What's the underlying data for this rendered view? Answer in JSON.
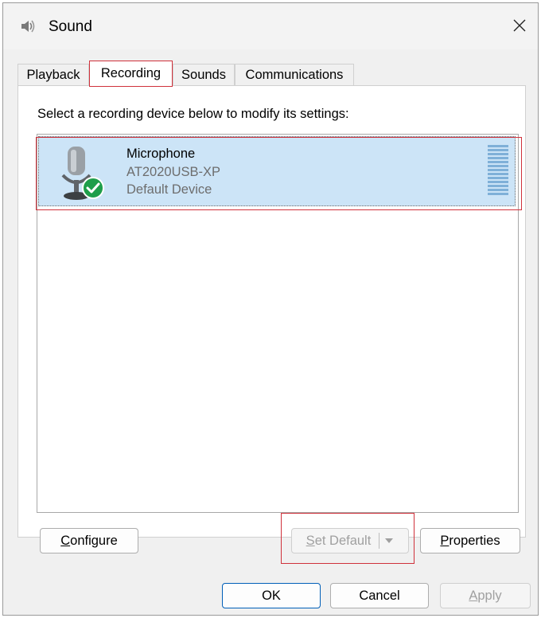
{
  "window": {
    "title": "Sound",
    "icon": "speaker-icon",
    "close_icon": "close-icon"
  },
  "tabs": [
    {
      "label": "Playback",
      "active": false
    },
    {
      "label": "Recording",
      "active": true
    },
    {
      "label": "Sounds",
      "active": false
    },
    {
      "label": "Communications",
      "active": false
    }
  ],
  "panel": {
    "instruction": "Select a recording device below to modify its settings:",
    "devices": [
      {
        "name": "Microphone",
        "model": "AT2020USB-XP",
        "status": "Default Device",
        "selected": true,
        "icon": "microphone-icon",
        "badge_icon": "checkmark-icon"
      }
    ],
    "buttons": {
      "configure_pre": "",
      "configure_key": "C",
      "configure_post": "onfigure",
      "set_default_pre": "",
      "set_default_key": "S",
      "set_default_post": "et Default",
      "set_default_enabled": false,
      "properties_pre": "",
      "properties_key": "P",
      "properties_post": "roperties"
    }
  },
  "footer": {
    "ok": "OK",
    "cancel": "Cancel",
    "apply_key": "A",
    "apply_post": "pply",
    "apply_enabled": false
  },
  "colors": {
    "selection": "#cce4f7",
    "highlight": "#d0313b",
    "check_badge": "#1e9e4a",
    "primary_border": "#005fb8"
  }
}
